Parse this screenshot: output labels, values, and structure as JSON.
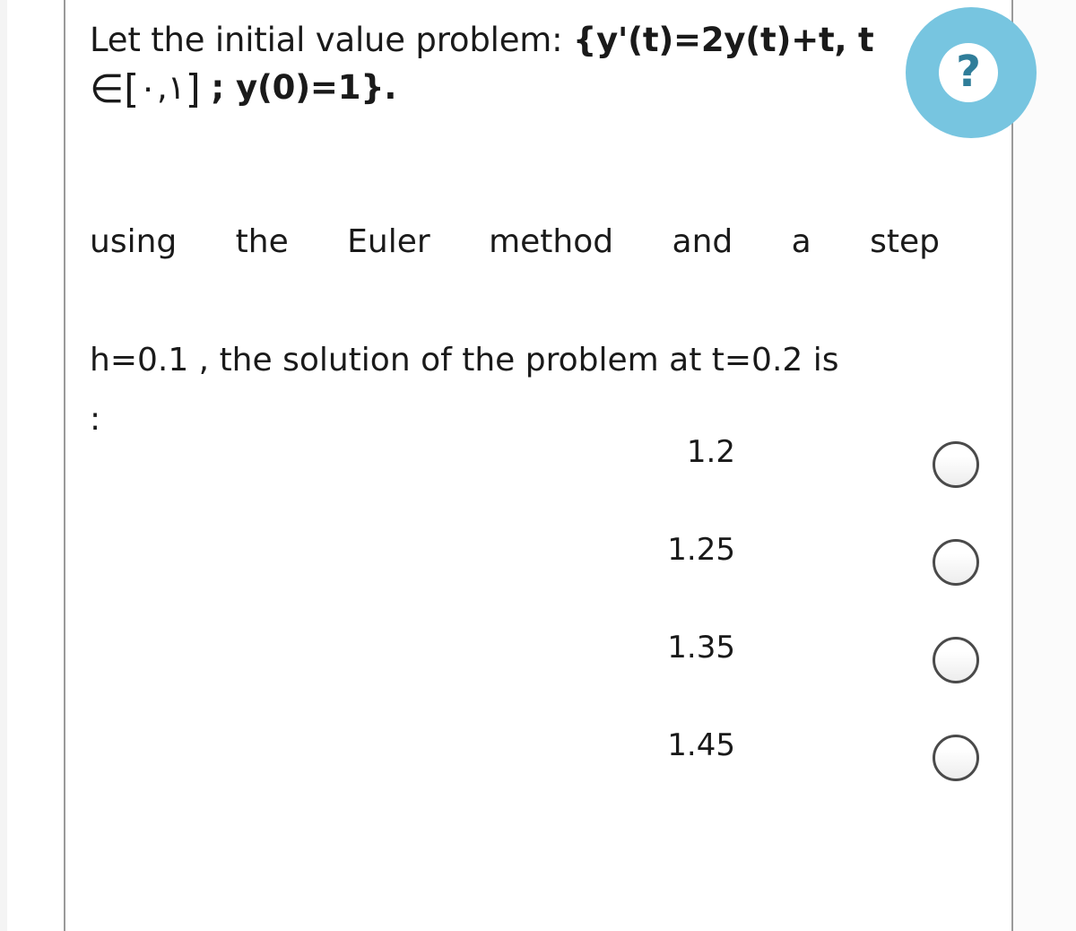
{
  "question": {
    "stem_prefix": "Let the initial value problem:",
    "stem_equation": "{y'(t)=2y(t)+t, t",
    "stem_domain_open": "∈[",
    "stem_domain_values": "٠,١",
    "stem_domain_close": "]",
    "stem_condition": "; y(0)=1}.",
    "body_line1": "using the Euler method and a step",
    "body_line2": "h=0.1 , the solution of the problem at t=0.2 is",
    "body_line3": ":"
  },
  "help": {
    "icon": "question-mark-icon",
    "glyph": "?",
    "circle_color": "#77c5e0",
    "glyph_color": "#2f7d99"
  },
  "options": [
    {
      "label": "1.2",
      "selected": false
    },
    {
      "label": "1.25",
      "selected": false
    },
    {
      "label": "1.35",
      "selected": false
    },
    {
      "label": "1.45",
      "selected": false
    }
  ],
  "colors": {
    "text": "#1a1a1a",
    "rule": "#9a9a9a",
    "panel": "#ffffff",
    "page_background": "#f7f7f7",
    "radio_border": "#4a4a4a"
  }
}
